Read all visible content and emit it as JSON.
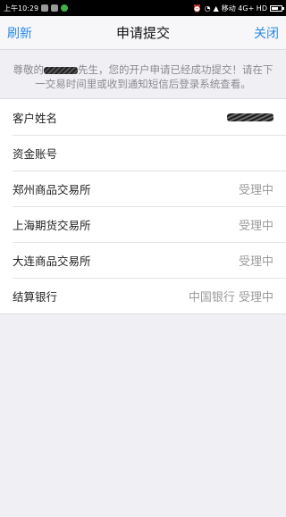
{
  "status_bar": {
    "time": "上午10:29",
    "carrier": "移动 4G+ HD"
  },
  "nav": {
    "left_label": "刷新",
    "title": "申请提交",
    "right_label": "关闭"
  },
  "notice": {
    "prefix": "尊敬的",
    "suffix": "先生，您的开户申请已经成功提交！请在下一交易时间里或收到通知短信后登录系统查看。"
  },
  "rows": [
    {
      "label": "客户姓名",
      "value": ""
    },
    {
      "label": "资金账号",
      "value": ""
    },
    {
      "label": "郑州商品交易所",
      "value": "受理中"
    },
    {
      "label": "上海期货交易所",
      "value": "受理中"
    },
    {
      "label": "大连商品交易所",
      "value": "受理中"
    },
    {
      "label": "结算银行",
      "value": "中国银行 受理中"
    }
  ]
}
